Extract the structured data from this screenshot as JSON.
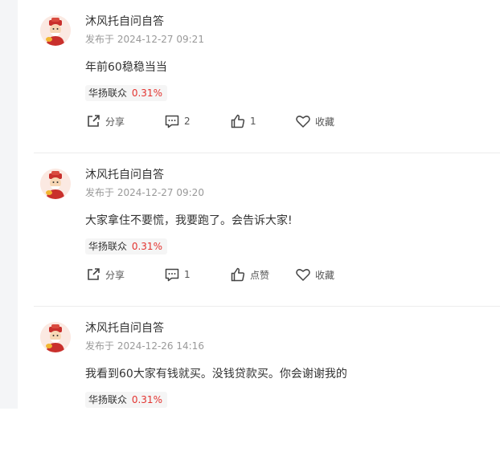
{
  "posts": [
    {
      "author": "沐风托自问自答",
      "date": "发布于 2024-12-27 09:21",
      "content": "年前60稳稳当当",
      "stock": {
        "name": "华扬联众",
        "change": "0.31%"
      },
      "share_label": "分享",
      "comment_count": "2",
      "like_label": "1",
      "favorite_label": "收藏"
    },
    {
      "author": "沐风托自问自答",
      "date": "发布于 2024-12-27 09:20",
      "content": "大家拿住不要慌，我要跑了。会告诉大家!",
      "stock": {
        "name": "华扬联众",
        "change": "0.31%"
      },
      "share_label": "分享",
      "comment_count": "1",
      "like_label": "点赞",
      "favorite_label": "收藏"
    },
    {
      "author": "沐风托自问自答",
      "date": "发布于 2024-12-26 14:16",
      "content": "我看到60大家有钱就买。没钱贷款买。你会谢谢我的",
      "stock": {
        "name": "华扬联众",
        "change": "0.31%"
      }
    }
  ],
  "colors": {
    "stock_change": "#e3332f",
    "meta": "#999999",
    "text": "#333333"
  }
}
